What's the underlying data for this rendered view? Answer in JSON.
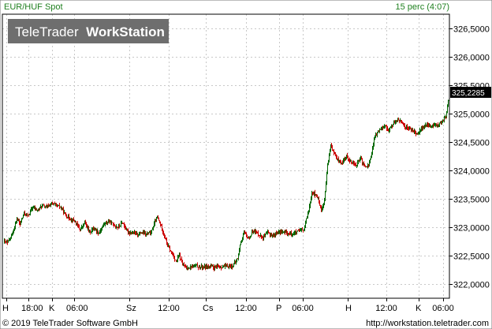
{
  "header": {
    "symbol": "EUR/HUF Spot",
    "interval": "15 perc (4:07)"
  },
  "watermark": {
    "brand": "TeleTrader",
    "product": "WorkStation"
  },
  "footer": {
    "copyright": "© 2019 TeleTrader Software GmbH",
    "url": "http://workstation.teletrader.com"
  },
  "colors": {
    "up": "#006600",
    "down": "#cc0000",
    "grid": "#c8c8c8",
    "header_text": "#208020",
    "logo_bg": "#6e6e6e",
    "last_price_bg": "#000000"
  },
  "chart_data": {
    "type": "candlestick",
    "symbol": "EUR/HUF Spot",
    "interval": "15 perc",
    "last_price_label": "325,2285",
    "last_price": 325.2285,
    "ylim": [
      321.75,
      326.75
    ],
    "y_ticks": [
      {
        "value": 322.0,
        "label": "322,0000"
      },
      {
        "value": 322.5,
        "label": "322,5000"
      },
      {
        "value": 323.0,
        "label": "323,0000"
      },
      {
        "value": 323.5,
        "label": "323,5000"
      },
      {
        "value": 324.0,
        "label": "324,0000"
      },
      {
        "value": 324.5,
        "label": "324,5000"
      },
      {
        "value": 325.0,
        "label": "325,0000"
      },
      {
        "value": 325.5,
        "label": "325,5000"
      },
      {
        "value": 326.0,
        "label": "326,0000"
      },
      {
        "value": 326.5,
        "label": "326,5000"
      }
    ],
    "x_ticks": [
      "H",
      "18:00",
      "K",
      "06:00",
      "Sz",
      "12:00",
      "Cs",
      "12:00",
      "P",
      "06:00",
      "H",
      "12:00",
      "K",
      "06:00"
    ],
    "grid": true,
    "path": [
      [
        0,
        322.75
      ],
      [
        4,
        322.72
      ],
      [
        8,
        322.82
      ],
      [
        12,
        322.95
      ],
      [
        16,
        323.15
      ],
      [
        20,
        323.05
      ],
      [
        25,
        323.25
      ],
      [
        30,
        323.2
      ],
      [
        36,
        323.35
      ],
      [
        42,
        323.3
      ],
      [
        48,
        323.38
      ],
      [
        54,
        323.35
      ],
      [
        60,
        323.42
      ],
      [
        66,
        323.38
      ],
      [
        72,
        323.35
      ],
      [
        78,
        323.2
      ],
      [
        84,
        323.15
      ],
      [
        90,
        323.1
      ],
      [
        96,
        322.95
      ],
      [
        102,
        323.08
      ],
      [
        108,
        322.92
      ],
      [
        114,
        322.98
      ],
      [
        120,
        322.9
      ],
      [
        126,
        323.05
      ],
      [
        132,
        323.1
      ],
      [
        138,
        323.05
      ],
      [
        144,
        323.0
      ],
      [
        150,
        323.08
      ],
      [
        156,
        322.92
      ],
      [
        162,
        322.9
      ],
      [
        168,
        322.88
      ],
      [
        174,
        322.9
      ],
      [
        180,
        322.88
      ],
      [
        186,
        322.9
      ],
      [
        190,
        323.05
      ],
      [
        194,
        323.18
      ],
      [
        198,
        323.05
      ],
      [
        202,
        322.9
      ],
      [
        206,
        322.72
      ],
      [
        210,
        322.6
      ],
      [
        214,
        322.5
      ],
      [
        218,
        322.4
      ],
      [
        222,
        322.5
      ],
      [
        226,
        322.35
      ],
      [
        230,
        322.28
      ],
      [
        236,
        322.3
      ],
      [
        242,
        322.32
      ],
      [
        250,
        322.3
      ],
      [
        258,
        322.31
      ],
      [
        266,
        322.29
      ],
      [
        274,
        322.3
      ],
      [
        282,
        322.31
      ],
      [
        290,
        322.32
      ],
      [
        296,
        322.45
      ],
      [
        300,
        322.75
      ],
      [
        304,
        322.9
      ],
      [
        310,
        322.8
      ],
      [
        316,
        322.95
      ],
      [
        322,
        322.88
      ],
      [
        328,
        322.82
      ],
      [
        334,
        322.9
      ],
      [
        340,
        322.85
      ],
      [
        346,
        322.9
      ],
      [
        352,
        322.92
      ],
      [
        358,
        322.9
      ],
      [
        364,
        322.88
      ],
      [
        372,
        322.92
      ],
      [
        380,
        322.95
      ],
      [
        386,
        323.3
      ],
      [
        390,
        323.62
      ],
      [
        394,
        323.58
      ],
      [
        398,
        323.5
      ],
      [
        402,
        323.3
      ],
      [
        406,
        323.45
      ],
      [
        410,
        324.1
      ],
      [
        414,
        324.45
      ],
      [
        418,
        324.3
      ],
      [
        422,
        324.2
      ],
      [
        428,
        324.12
      ],
      [
        434,
        324.25
      ],
      [
        440,
        324.15
      ],
      [
        446,
        324.1
      ],
      [
        452,
        324.2
      ],
      [
        458,
        324.05
      ],
      [
        462,
        324.1
      ],
      [
        466,
        324.3
      ],
      [
        470,
        324.6
      ],
      [
        476,
        324.72
      ],
      [
        482,
        324.8
      ],
      [
        488,
        324.7
      ],
      [
        494,
        324.85
      ],
      [
        500,
        324.9
      ],
      [
        506,
        324.8
      ],
      [
        512,
        324.75
      ],
      [
        518,
        324.7
      ],
      [
        524,
        324.65
      ],
      [
        530,
        324.75
      ],
      [
        536,
        324.8
      ],
      [
        542,
        324.78
      ],
      [
        548,
        324.8
      ],
      [
        554,
        324.82
      ],
      [
        560,
        324.95
      ],
      [
        563,
        325.22
      ]
    ]
  }
}
